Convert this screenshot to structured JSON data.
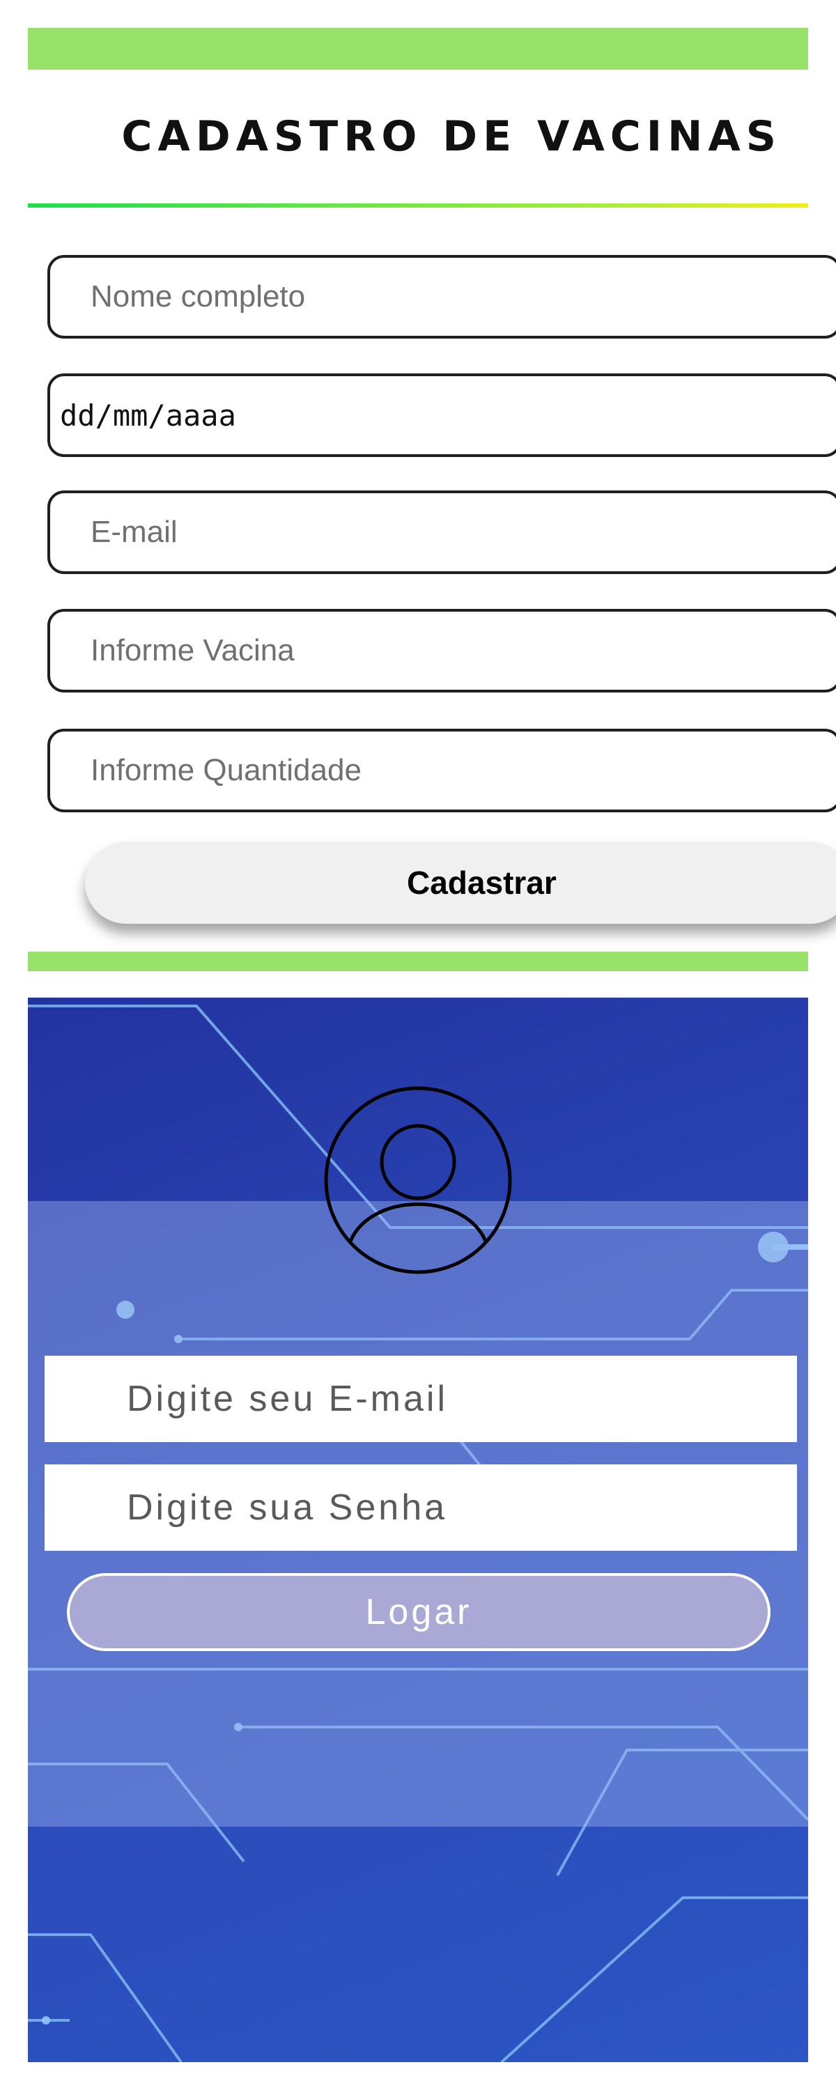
{
  "vaccine_form": {
    "title": "CADASTRO DE VACINAS",
    "fields": {
      "name_placeholder": "Nome completo",
      "date_value": "dd/mm/aaaa",
      "email_placeholder": "E-mail",
      "vaccine_placeholder": "Informe Vacina",
      "quantity_placeholder": "Informe Quantidade"
    },
    "submit_label": "Cadastrar"
  },
  "login": {
    "avatar_icon": "user-circle-icon",
    "email_placeholder": "Digite seu E-mail",
    "password_placeholder": "Digite sua Senha",
    "submit_label": "Logar"
  },
  "colors": {
    "green_bar": "#98e26a",
    "login_bg": "#2a46b4",
    "login_button": "#aaa9d6"
  }
}
